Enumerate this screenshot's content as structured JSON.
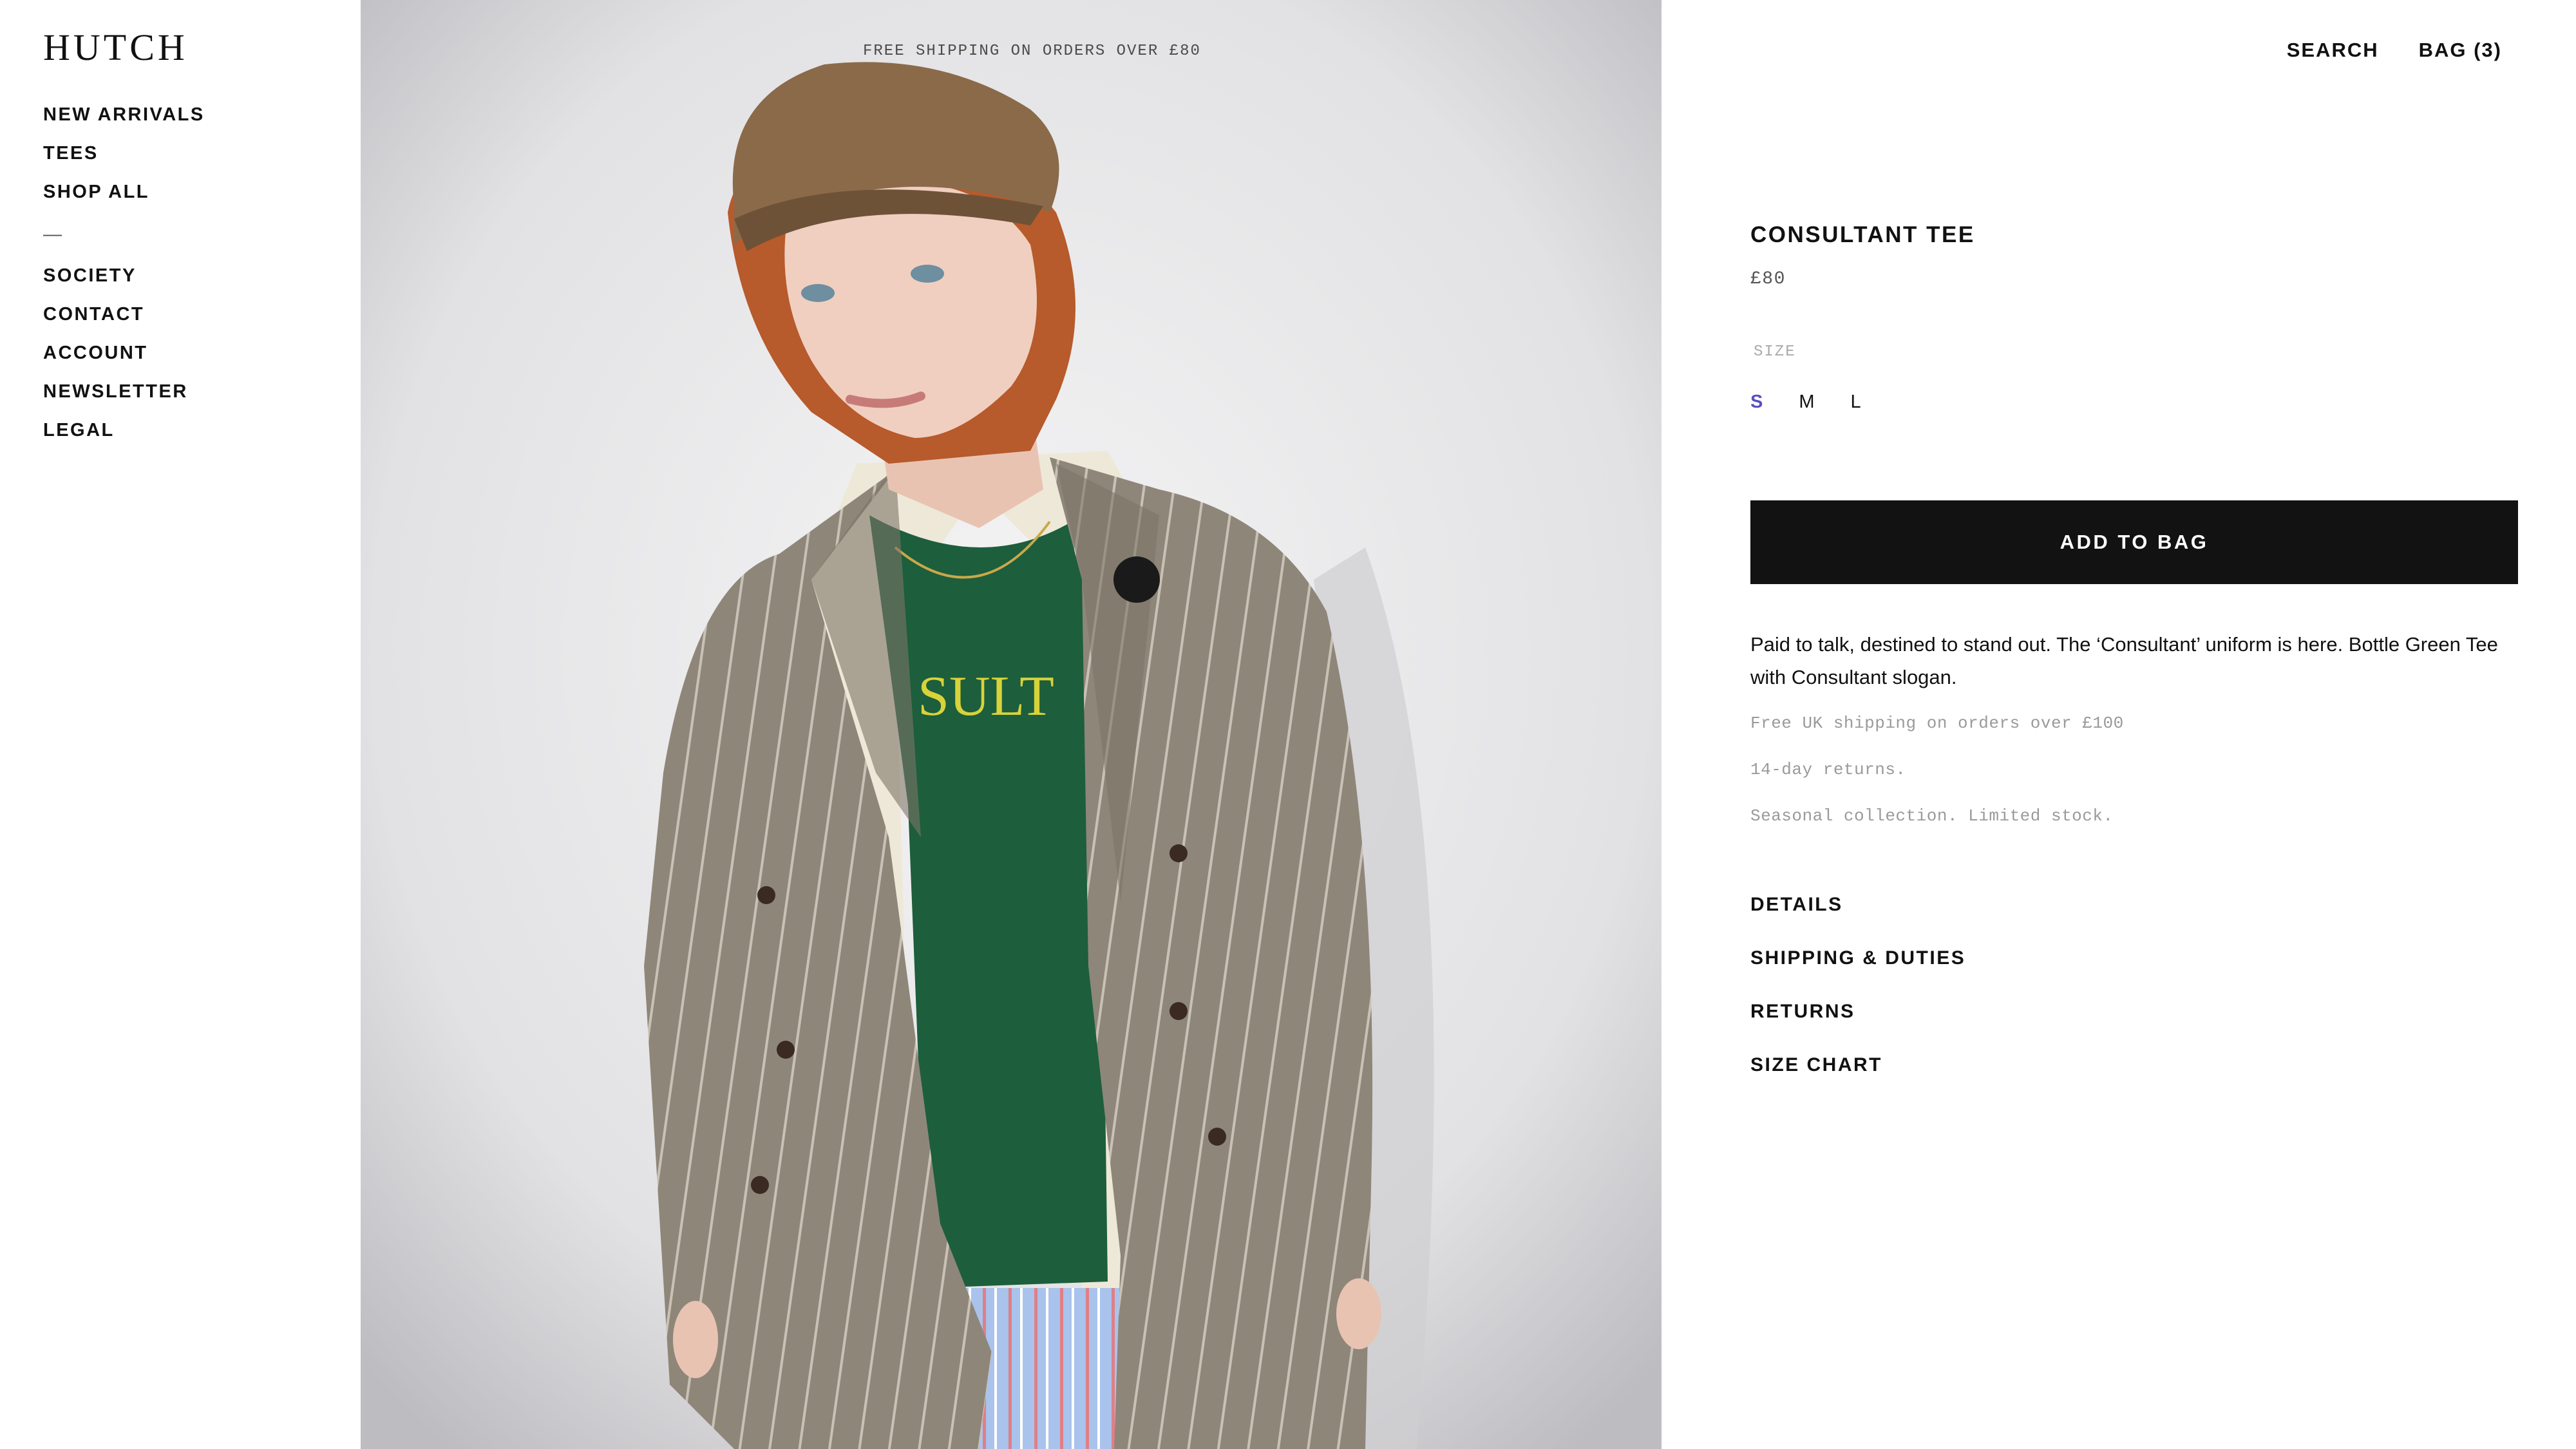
{
  "brand": {
    "logo": "HUTCH"
  },
  "nav": {
    "items": [
      "NEW ARRIVALS",
      "TEES",
      "SHOP ALL"
    ],
    "separator": "—",
    "secondary": [
      "SOCIETY",
      "CONTACT",
      "ACCOUNT",
      "NEWSLETTER",
      "LEGAL"
    ]
  },
  "promo": "FREE SHIPPING ON ORDERS OVER £80",
  "header": {
    "search": "SEARCH",
    "bag": "BAG (3)"
  },
  "product": {
    "title": "CONSULTANT TEE",
    "price": "£80",
    "size_label": "SIZE",
    "sizes": [
      "S",
      "M",
      "L"
    ],
    "selected_size": "S",
    "add_button": "ADD TO BAG",
    "description": "Paid to talk, destined to stand out. The ‘Consultant’ uniform is here. Bottle Green Tee with Consultant slogan.",
    "notes": [
      "Free UK shipping on orders over £100",
      "14-day returns.",
      "Seasonal collection. Limited stock."
    ],
    "accordion": [
      "DETAILS",
      "SHIPPING & DUTIES",
      "RETURNS",
      "SIZE CHART"
    ]
  },
  "hero": {
    "tee_text": "SULT"
  },
  "colors": {
    "accent": "#5a4fc4",
    "button": "#121212",
    "tee": "#1d5e3c",
    "blazer": "#8d8377"
  }
}
